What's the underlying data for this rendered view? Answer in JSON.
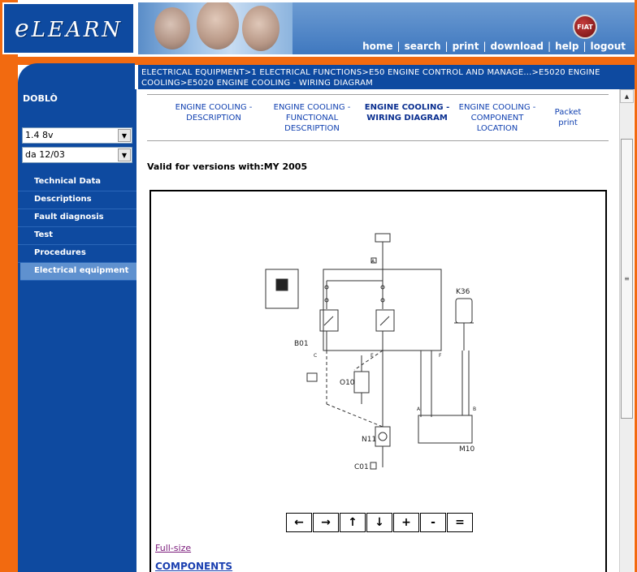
{
  "brand": {
    "logo_prefix": "e",
    "logo_rest": "LEARN",
    "badge": "FIAT"
  },
  "topnav": [
    "home",
    "search",
    "print",
    "download",
    "help",
    "logout"
  ],
  "breadcrumb": "ELECTRICAL EQUIPMENT>1 ELECTRICAL FUNCTIONS>E50 ENGINE CONTROL AND MANAGE...>E5020 ENGINE COOLING>E5020 ENGINE COOLING - WIRING DIAGRAM",
  "sidebar": {
    "model": "DOBLÒ",
    "engine_select": "1.4 8v",
    "date_select": "da 12/03",
    "menu": [
      "Technical Data",
      "Descriptions",
      "Fault diagnosis",
      "Test",
      "Procedures",
      "Electrical equipment"
    ],
    "active_index": 5
  },
  "tabs": [
    {
      "label": "ENGINE COOLING - DESCRIPTION"
    },
    {
      "label": "ENGINE COOLING - FUNCTIONAL DESCRIPTION"
    },
    {
      "label": "ENGINE COOLING - WIRING DIAGRAM"
    },
    {
      "label": "ENGINE COOLING - COMPONENT LOCATION"
    },
    {
      "label": "Packet print"
    }
  ],
  "active_tab": 2,
  "valid_text": "Valid for versions with:MY 2005",
  "diagram": {
    "labels": {
      "b01": "B01",
      "k36": "K36",
      "o10": "O10",
      "n11": "N11",
      "m10": "M10",
      "c01": "C01",
      "conn_a": "A",
      "conn_b": "B",
      "conn_c": "C",
      "conn_e": "E",
      "conn_f": "F"
    }
  },
  "diagram_controls": [
    "←",
    "→",
    "↑",
    "↓",
    "+",
    "-",
    "="
  ],
  "fullsize_link": "Full-size",
  "components_heading": "COMPONENTS",
  "colors": {
    "brand_blue": "#0e4aa0",
    "accent_orange": "#f26a10",
    "link_blue": "#1040b0"
  }
}
